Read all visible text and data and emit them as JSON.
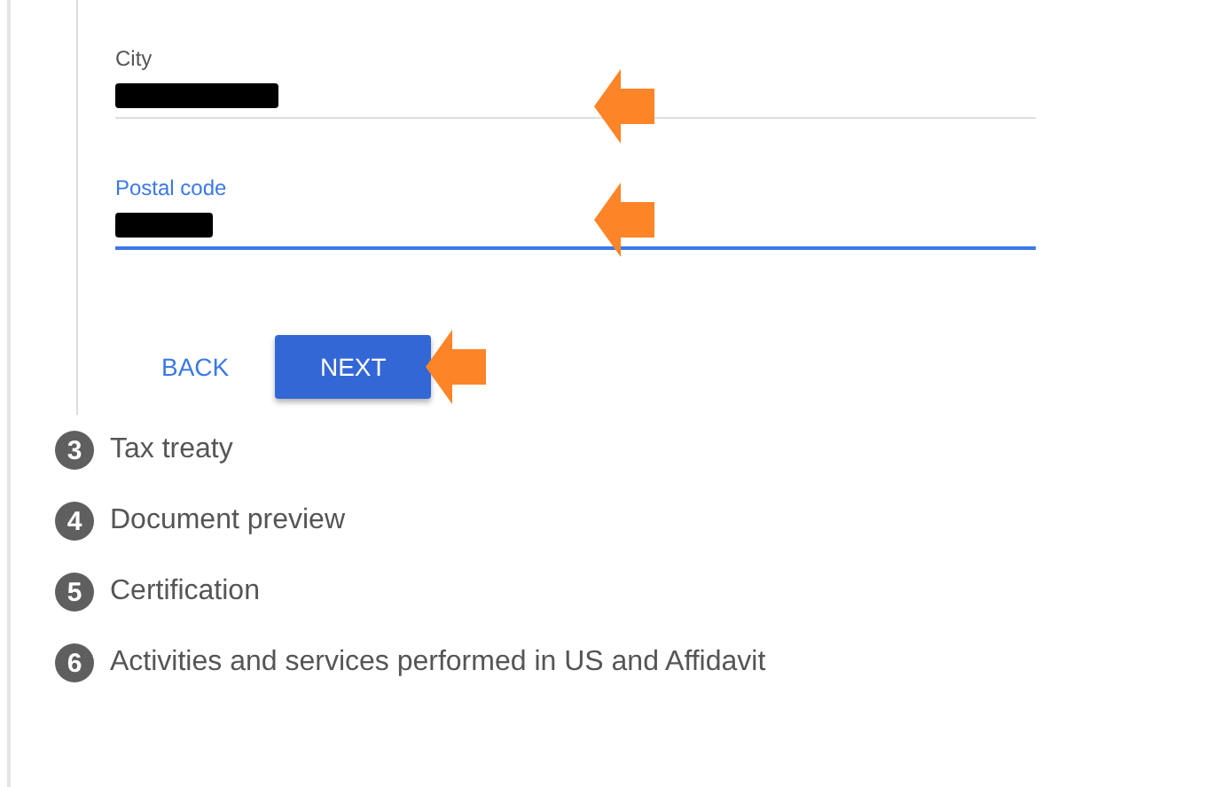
{
  "fields": [
    {
      "label": "City",
      "focused": false,
      "redacted": true,
      "arrow": true
    },
    {
      "label": "Postal code",
      "focused": true,
      "redacted": true,
      "arrow": true
    }
  ],
  "buttons": [
    {
      "kind": "text",
      "label": "BACK",
      "arrow": false
    },
    {
      "kind": "raised",
      "label": "NEXT",
      "arrow": true
    }
  ],
  "steps": [
    {
      "number": "3",
      "label": "Tax treaty"
    },
    {
      "number": "4",
      "label": "Document preview"
    },
    {
      "number": "5",
      "label": "Certification"
    },
    {
      "number": "6",
      "label": "Activities and services performed in US and Affidavit"
    }
  ]
}
